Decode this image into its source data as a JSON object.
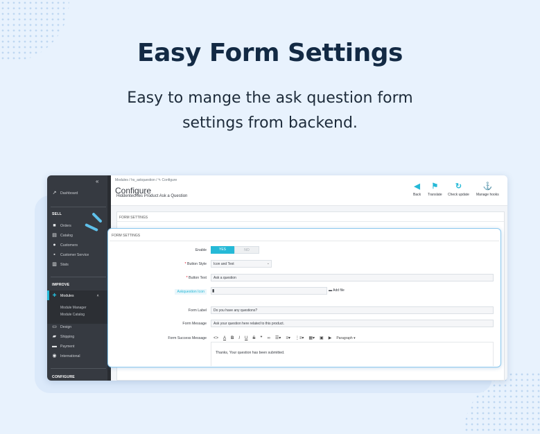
{
  "hero": {
    "title": "Easy Form Settings",
    "subtitle_line1": "Easy to mange the ask question form",
    "subtitle_line2": "settings from backend."
  },
  "sidebar": {
    "collapse_icon": "double-chevron-left-icon",
    "dashboard": "Dashboard",
    "sell_heading": "SELL",
    "sell_items": [
      "Orders",
      "Catalog",
      "Customers",
      "Customer Service",
      "Stats"
    ],
    "improve_heading": "IMPROVE",
    "modules": "Modules",
    "modules_sub": [
      "Module Manager",
      "Module Catalog"
    ],
    "improve_items": [
      "Design",
      "Shipping",
      "Payment",
      "International"
    ],
    "configure_heading": "CONFIGURE"
  },
  "header": {
    "breadcrumb": "Modules  /  hs_askquestion  /  ✎ Configure",
    "title": "Configure",
    "subtitle": "Hiddentechies Product Ask a Question",
    "buttons": [
      "Back",
      "Translate",
      "Check update",
      "Manage hooks"
    ]
  },
  "back_panel": {
    "heading": "FORM SETTINGS"
  },
  "form": {
    "heading": "FORM SETTINGS",
    "enable_label": "Enable",
    "enable_yes": "YES",
    "enable_no": "NO",
    "button_style_label": "Button Style",
    "button_style_value": "Icon and Text",
    "button_text_label": "Button Text",
    "button_text_value": "Ask a question",
    "icon_label": "Askquestion Icon",
    "add_file": "Add file",
    "form_label_label": "Form Label",
    "form_label_value": "Do you have any questions?",
    "form_message_label": "Form Message",
    "form_message_value": "Ask your question here related to this product.",
    "success_label": "Form Success Message",
    "paragraph": "Paragraph",
    "success_value": "Thanks,  Your question has been submitted."
  },
  "colors": {
    "accent": "#25b9d7",
    "sidebar": "#363a41",
    "heading": "#132a44"
  }
}
